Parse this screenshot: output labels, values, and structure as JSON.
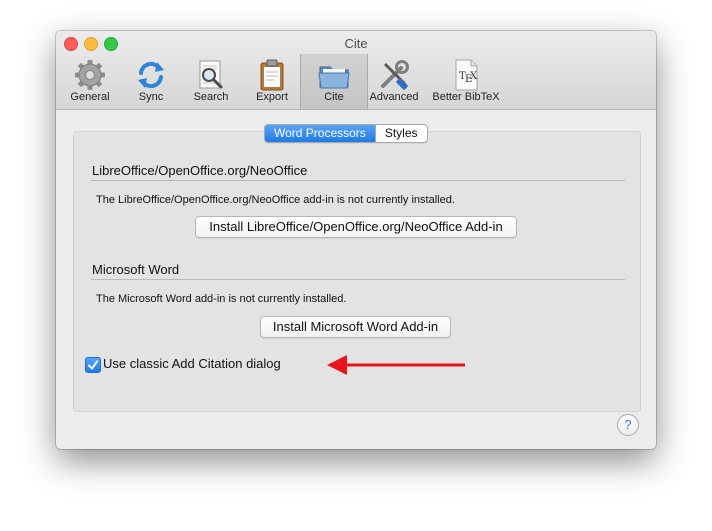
{
  "window": {
    "title": "Cite"
  },
  "toolbar": {
    "items": [
      {
        "label": "General",
        "icon": "gear-icon"
      },
      {
        "label": "Sync",
        "icon": "sync-icon"
      },
      {
        "label": "Search",
        "icon": "search-icon"
      },
      {
        "label": "Export",
        "icon": "clipboard-icon"
      },
      {
        "label": "Cite",
        "icon": "folder-icon"
      },
      {
        "label": "Advanced",
        "icon": "tools-icon"
      },
      {
        "label": "Better BibTeX",
        "icon": "tex-document-icon"
      }
    ],
    "selected": "Cite"
  },
  "tabs": {
    "word_processors": "Word Processors",
    "styles": "Styles",
    "active": "Word Processors"
  },
  "libreoffice": {
    "title": "LibreOffice/OpenOffice.org/NeoOffice",
    "status": "The LibreOffice/OpenOffice.org/NeoOffice add-in is not currently installed.",
    "button": "Install LibreOffice/OpenOffice.org/NeoOffice Add-in"
  },
  "msword": {
    "title": "Microsoft Word",
    "status": "The Microsoft Word add-in is not currently installed.",
    "button": "Install Microsoft Word Add-in"
  },
  "classic_dialog": {
    "label": "Use classic Add Citation dialog",
    "checked": true
  },
  "help": {
    "label": "?"
  },
  "annotation": {
    "color": "#e8141b"
  },
  "colors": {
    "accent": "#1f7ae9",
    "window_bg": "#ececec",
    "panel_bg": "#e3e3e3"
  }
}
